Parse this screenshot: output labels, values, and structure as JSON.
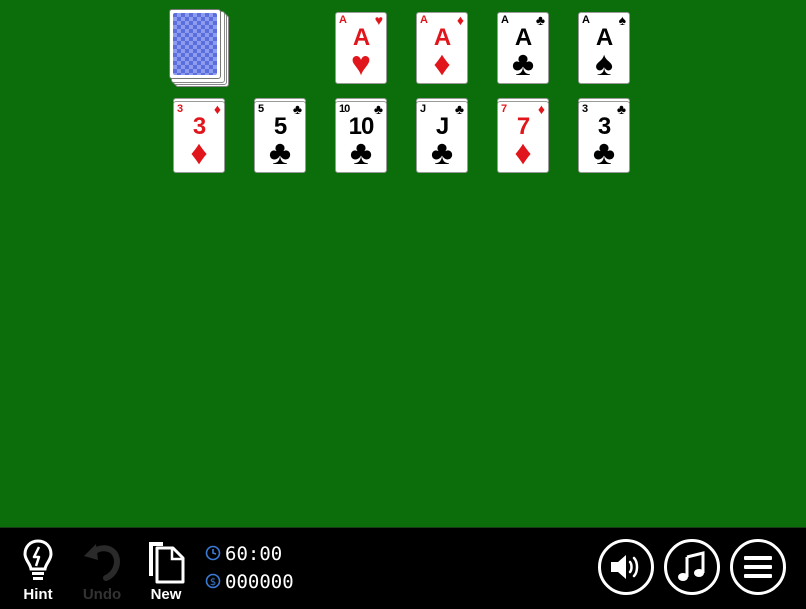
{
  "foundations": [
    {
      "rank": "A",
      "suit": "♥",
      "color": "red"
    },
    {
      "rank": "A",
      "suit": "♦",
      "color": "red"
    },
    {
      "rank": "A",
      "suit": "♣",
      "color": "black"
    },
    {
      "rank": "A",
      "suit": "♠",
      "color": "black"
    }
  ],
  "tableau": [
    {
      "rank": "3",
      "suit": "♦",
      "color": "red"
    },
    {
      "rank": "5",
      "suit": "♣",
      "color": "black"
    },
    {
      "rank": "10",
      "suit": "♣",
      "color": "black"
    },
    {
      "rank": "J",
      "suit": "♣",
      "color": "black"
    },
    {
      "rank": "7",
      "suit": "♦",
      "color": "red"
    },
    {
      "rank": "3",
      "suit": "♣",
      "color": "black"
    }
  ],
  "toolbar": {
    "hint_label": "Hint",
    "undo_label": "Undo",
    "new_label": "New"
  },
  "stats": {
    "time": "60:00",
    "score": "000000"
  },
  "colors": {
    "felt": "#0b6e0b",
    "red_suit": "#e0161c",
    "card_back": "#5a6fdc",
    "clock_icon": "#3b7bd6"
  }
}
